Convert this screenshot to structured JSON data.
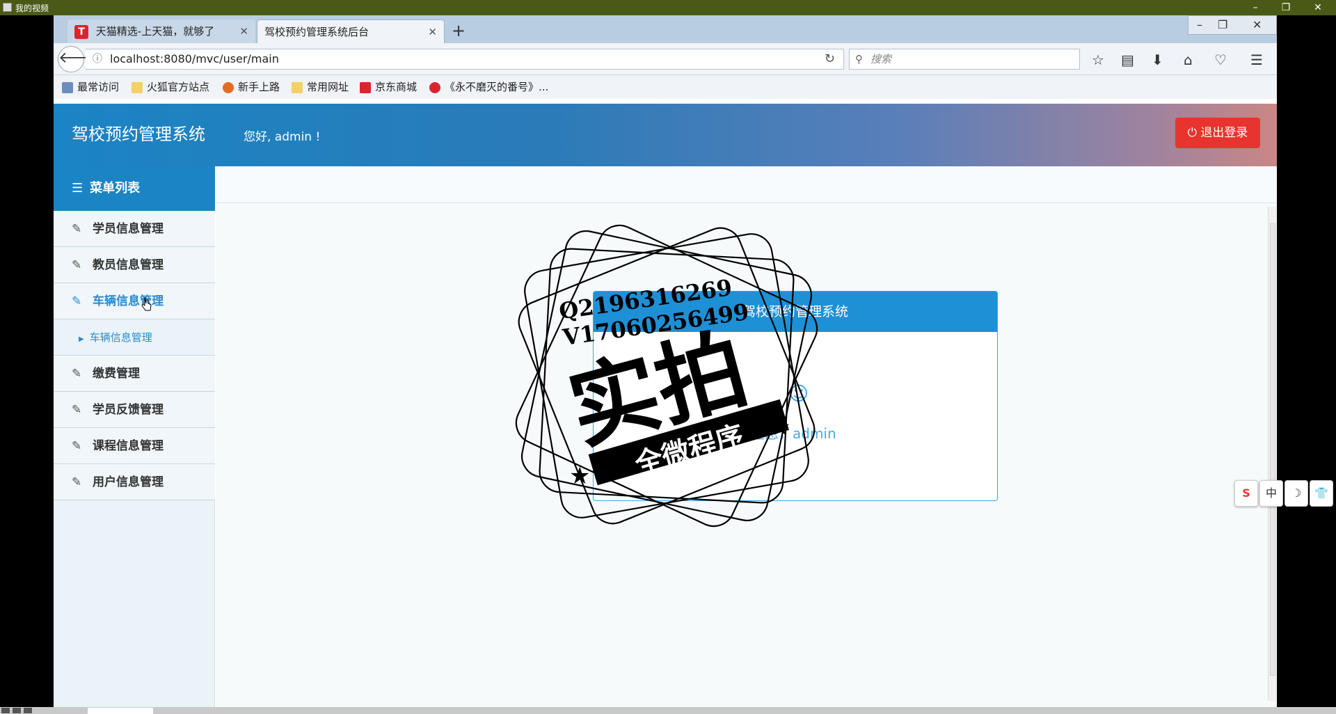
{
  "player": {
    "title": "我的视频",
    "controls": [
      "–",
      "❐",
      "✕"
    ]
  },
  "browser": {
    "tabs": [
      {
        "label": "天猫精选-上天猫，就够了",
        "icon": "T",
        "close": "✕"
      },
      {
        "label": "驾校预约管理系统后台",
        "close": "✕"
      }
    ],
    "new_tab": "+",
    "window_controls": [
      "–",
      "❐",
      "✕"
    ],
    "url": "localhost:8080/mvc/user/main",
    "search_placeholder": "搜索",
    "bookmarks": [
      "最常访问",
      "火狐官方站点",
      "新手上路",
      "常用网址",
      "京东商城",
      "《永不磨灭的番号》..."
    ]
  },
  "app": {
    "title": "驾校预约管理系统",
    "greeting": "您好, admin !",
    "logout_label": "退出登录",
    "menu_title": "菜单列表",
    "menu": [
      {
        "label": "学员信息管理"
      },
      {
        "label": "教员信息管理"
      },
      {
        "label": "车辆信息管理"
      },
      {
        "label": "车辆信息管理",
        "sub": true
      },
      {
        "label": "缴费管理"
      },
      {
        "label": "学员反馈管理"
      },
      {
        "label": "课程信息管理"
      },
      {
        "label": "用户信息管理"
      }
    ],
    "welcome_header": "驾校预约管理系统",
    "welcome_text": "欢迎您，admin"
  },
  "watermark": {
    "qq": "Q2196316269",
    "wechat": "V17060256499",
    "main": "实拍",
    "sub": "全微程序"
  },
  "floating_tools": [
    "S",
    "中",
    "☽",
    "👕"
  ],
  "colors": {
    "primary": "#1b84c4",
    "logout": "#e8342e",
    "link": "#2a8bd0"
  }
}
